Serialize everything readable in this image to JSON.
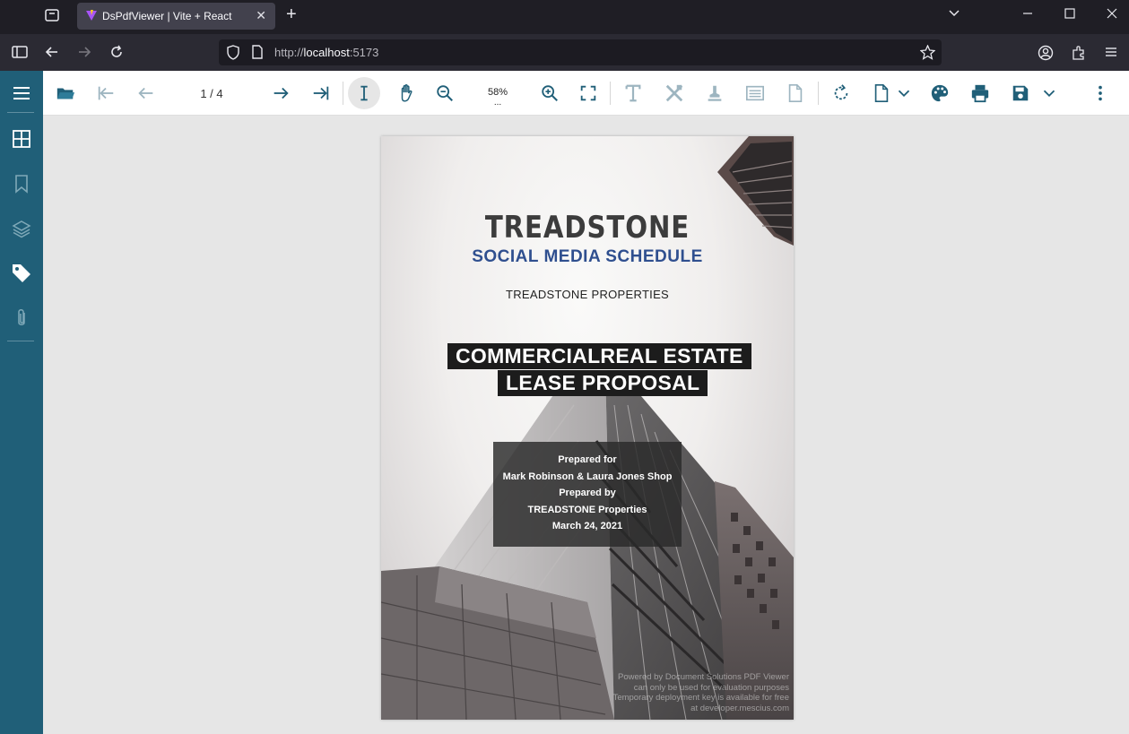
{
  "browser": {
    "tab_title": "DsPdfViewer | Vite + React",
    "tab_close": "✕",
    "new_tab": "+",
    "url_scheme": "http://",
    "url_host": "localhost",
    "url_port": ":5173"
  },
  "viewer": {
    "page_indicator": "1 / 4",
    "zoom_level": "58%",
    "zoom_more": "...",
    "accent_color": "#205f78"
  },
  "document": {
    "logo": "TREADSTONE",
    "subtitle": "SOCIAL MEDIA SCHEDULE",
    "company": "TREADSTONE PROPERTIES",
    "headline_line1": "COMMERCIALREAL ESTATE",
    "headline_line2": "LEASE PROPOSAL",
    "prepared_for_label": "Prepared for",
    "prepared_for": "Mark Robinson & Laura Jones Shop",
    "prepared_by_label": "Prepared by",
    "prepared_by": "TREADSTONE Properties",
    "date": "March 24, 2021",
    "watermark_lines": [
      "Powered by Document Solutions PDF Viewer",
      "can only be used for evaluation purposes",
      "Temporary deployment key is available for free",
      "at developer.mescius.com"
    ]
  }
}
